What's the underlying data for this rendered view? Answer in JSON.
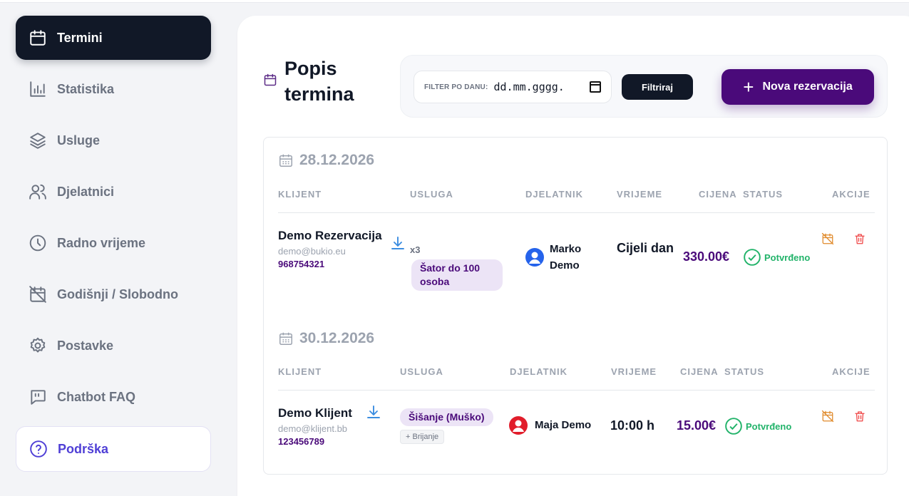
{
  "sidebar": {
    "items": [
      {
        "label": "Termini",
        "icon": "calendar-icon"
      },
      {
        "label": "Statistika",
        "icon": "bar-chart-icon"
      },
      {
        "label": "Usluge",
        "icon": "layers-icon"
      },
      {
        "label": "Djelatnici",
        "icon": "users-icon"
      },
      {
        "label": "Radno vrijeme",
        "icon": "clock-icon"
      },
      {
        "label": "Godišnji / Slobodno",
        "icon": "calendar-off-icon"
      },
      {
        "label": "Postavke",
        "icon": "gear-icon"
      },
      {
        "label": "Chatbot FAQ",
        "icon": "chat-quote-icon"
      },
      {
        "label": "Podrška",
        "icon": "help-circle-icon"
      }
    ]
  },
  "main": {
    "title": "Popis termina",
    "filter": {
      "label": "FILTER PO DANU:",
      "placeholder": "dd.mm.gggg."
    },
    "filter_button": "Filtriraj",
    "new_button": "Nova rezervacija"
  },
  "columns": [
    "KLIJENT",
    "USLUGA",
    "DJELATNIK",
    "VRIJEME",
    "CIJENA",
    "STATUS",
    "AKCIJE"
  ],
  "days": [
    {
      "date": "28.12.2026",
      "booking": {
        "client_name": "Demo Rezervacija",
        "client_email": "demo@bukio.eu",
        "client_phone": "968754321",
        "quantity": "x3",
        "service": "Šator do 100 osoba",
        "employee": "Marko Demo",
        "time": "Cijeli dan",
        "price": "330.00€",
        "status": "Potvrđeno"
      }
    },
    {
      "date": "30.12.2026",
      "booking": {
        "client_name": "Demo Klijent",
        "client_email": "demo@klijent.bb",
        "client_phone": "123456789",
        "service": "Šišanje (Muško)",
        "addon": "+ Brijanje",
        "employee": "Maja Demo",
        "time": "10:00 h",
        "price": "15.00€",
        "status": "Potvrđeno"
      }
    }
  ],
  "colors": {
    "accent": "#4a0a7a",
    "success": "#22b36a",
    "dark": "#111827"
  }
}
